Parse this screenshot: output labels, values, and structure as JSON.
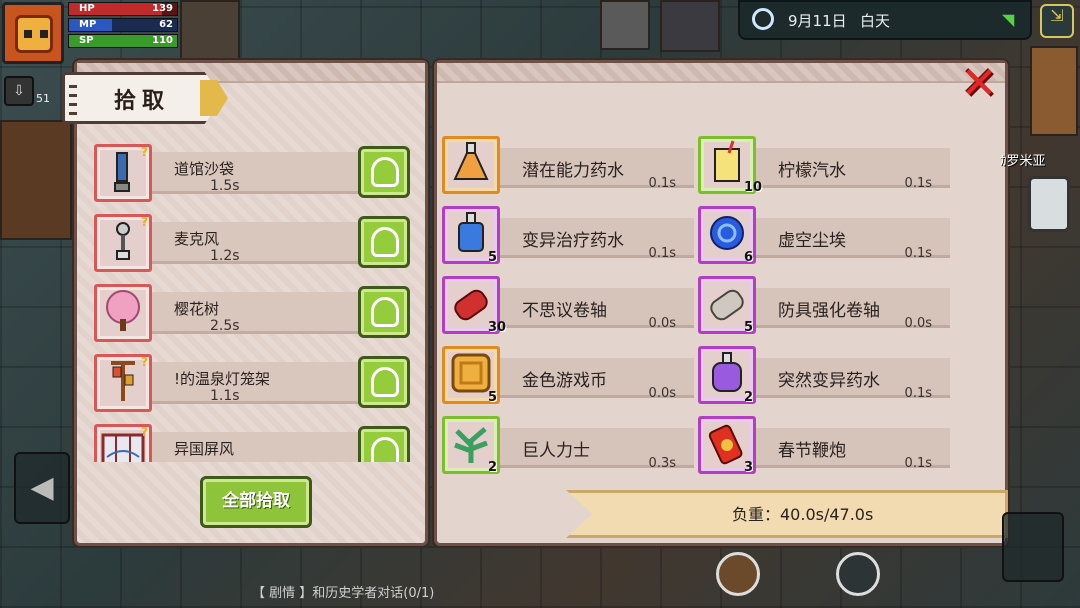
{
  "hud": {
    "hp_label": "HP",
    "hp_value": "139",
    "mp_label": "MP",
    "mp_value": "62",
    "sp_label": "SP",
    "sp_value": "110",
    "level_value": "51",
    "date": "9月11日",
    "time_of_day": "白天"
  },
  "pickup_panel": {
    "title": "拾取",
    "take_all_label": "全部拾取",
    "items": [
      {
        "name": "道馆沙袋",
        "time": "1.5s",
        "icon": "sandbag-icon"
      },
      {
        "name": "麦克风",
        "time": "1.2s",
        "icon": "microphone-icon"
      },
      {
        "name": "樱花树",
        "time": "2.5s",
        "icon": "cherry-tree-icon"
      },
      {
        "name": "!的温泉灯笼架",
        "time": "1.1s",
        "icon": "lantern-rack-icon"
      },
      {
        "name": "异国屏风",
        "time": "",
        "icon": "folding-screen-icon"
      }
    ]
  },
  "inventory_panel": {
    "items": [
      {
        "name": "潜在能力药水",
        "time": "0.1s",
        "qty": "",
        "frame": "orange",
        "icon": "potion-orange-icon"
      },
      {
        "name": "柠檬汽水",
        "time": "0.1s",
        "qty": "10",
        "frame": "green",
        "icon": "lemonade-icon"
      },
      {
        "name": "变异治疗药水",
        "time": "0.1s",
        "qty": "5",
        "frame": "purple",
        "icon": "potion-blue-icon"
      },
      {
        "name": "虚空尘埃",
        "time": "0.1s",
        "qty": "6",
        "frame": "purple",
        "icon": "void-dust-icon"
      },
      {
        "name": "不思议卷轴",
        "time": "0.0s",
        "qty": "30",
        "frame": "purple",
        "icon": "scroll-red-icon"
      },
      {
        "name": "防具强化卷轴",
        "time": "0.0s",
        "qty": "5",
        "frame": "purple",
        "icon": "scroll-grey-icon"
      },
      {
        "name": "金色游戏币",
        "time": "0.0s",
        "qty": "5",
        "frame": "orange",
        "icon": "gold-coin-icon"
      },
      {
        "name": "突然变异药水",
        "time": "0.1s",
        "qty": "2",
        "frame": "purple",
        "icon": "potion-purple-icon"
      },
      {
        "name": "巨人力士",
        "time": "0.3s",
        "qty": "2",
        "frame": "green",
        "icon": "herb-icon"
      },
      {
        "name": "春节鞭炮",
        "time": "0.1s",
        "qty": "3",
        "frame": "purple",
        "icon": "firecracker-icon"
      }
    ],
    "weight_text": "负重：40.0s/47.0s"
  },
  "world": {
    "npc_label": "ｶ罗米亚",
    "quest_text": "【 剧情 】和历史学者对话(0/1)"
  },
  "colors": {
    "take_button": "#95cc3c",
    "close_x": "#e02828",
    "frame_orange": "#e08a20",
    "frame_green": "#7dbd2e",
    "frame_purple": "#b23ec4"
  }
}
